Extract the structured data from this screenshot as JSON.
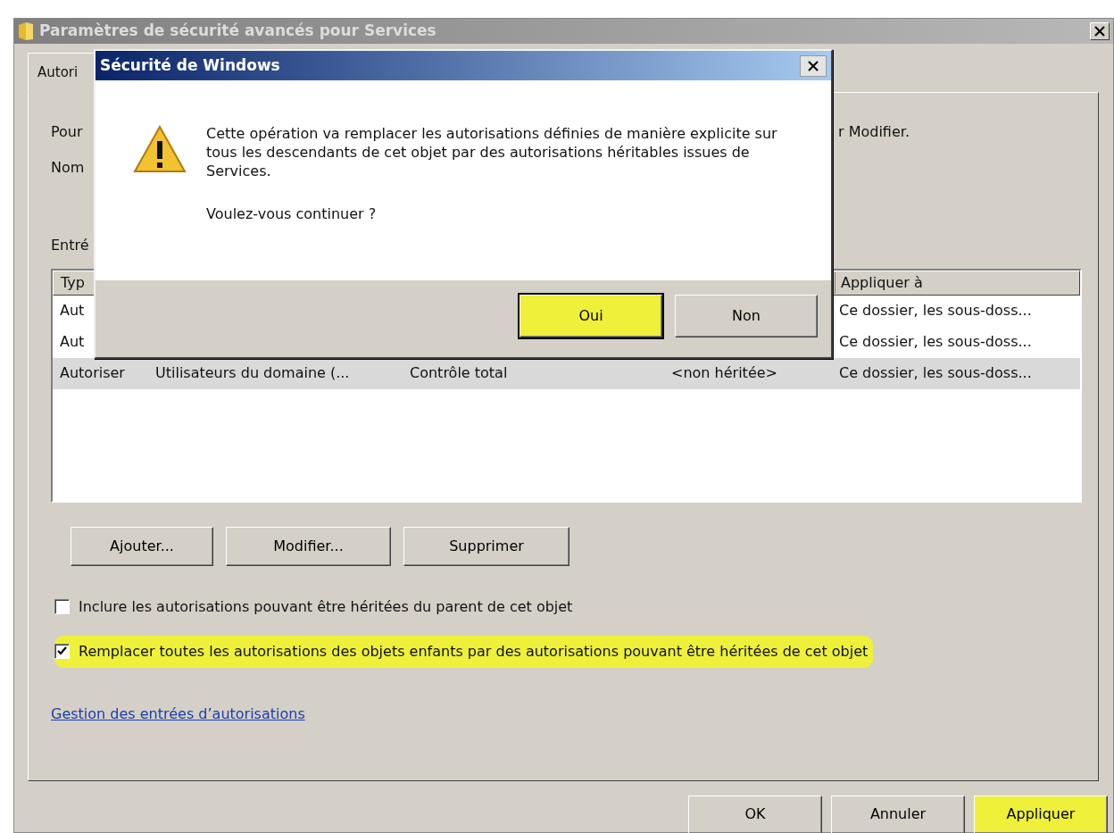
{
  "window": {
    "title": "Paramètres de sécurité avancés pour Services"
  },
  "tabs": [
    {
      "label": "Autori",
      "selected": true
    }
  ],
  "info_lines": [
    {
      "left": "Pour",
      "right": "r Modifier."
    },
    {
      "left": "Nom"
    }
  ],
  "entries_label": "Entré",
  "table": {
    "header": {
      "column_1": "Typ",
      "column_5": "Appliquer à"
    },
    "rows": [
      {
        "column_1": "Aut",
        "column_5": "Ce dossier, les sous-doss...",
        "selected": false
      },
      {
        "column_1": "Aut",
        "column_5": "Ce dossier, les sous-doss...",
        "selected": false
      },
      {
        "column_1": "Autoriser",
        "column_2": "Utilisateurs du domaine (...",
        "column_3": "Contrôle total",
        "column_4": "<non héritée>",
        "column_5": "Ce dossier, les sous-doss...",
        "selected": true
      }
    ]
  },
  "buttons": [
    {
      "label": "Ajouter..."
    },
    {
      "label": "Modifier..."
    },
    {
      "label": "Supprimer"
    }
  ],
  "checkboxes": [
    {
      "label": "Inclure les autorisations pouvant être héritées du parent de cet objet",
      "checked": false,
      "highlighted": false
    },
    {
      "label": "Remplacer toutes les autorisations des objets enfants par des autorisations pouvant être héritées de cet objet",
      "checked": true,
      "highlighted": true
    }
  ],
  "link": "Gestion des entrées d’autorisations",
  "footer_buttons": [
    {
      "label": "OK",
      "highlighted": false
    },
    {
      "label": "Annuler",
      "highlighted": false
    },
    {
      "label": "Appliquer",
      "highlighted": true
    }
  ],
  "dialog": {
    "title": "Sécurité de Windows",
    "message": "Cette opération va remplacer les autorisations définies de manière explicite sur tous les descendants de cet objet par des autorisations héritables issues de Services.",
    "question": "Voulez-vous continuer ?",
    "buttons": [
      {
        "label": "Oui",
        "default": true,
        "highlighted": true
      },
      {
        "label": "Non",
        "default": false,
        "highlighted": false
      }
    ]
  }
}
